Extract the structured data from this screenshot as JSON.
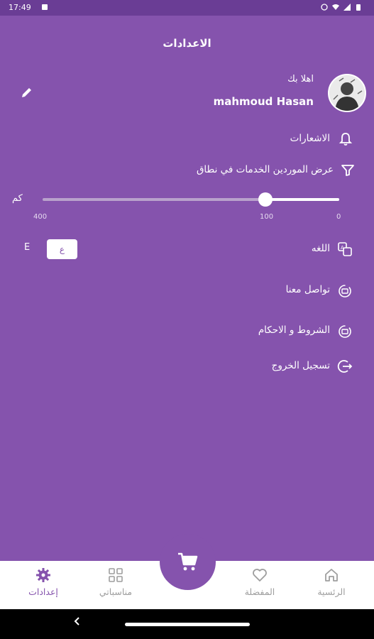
{
  "status_bar": {
    "time": "17:49"
  },
  "header": {
    "title": "الاعدادات"
  },
  "profile": {
    "greeting": "اهلا بك",
    "name": "mahmoud Hasan"
  },
  "settings": {
    "notifications_label": "الاشعارات",
    "range_label": "عرض الموردين الخدمات في نطاق",
    "range": {
      "unit": "كم",
      "min_label": "0",
      "mid_label": "100",
      "max_label": "400",
      "value_fraction": 0.25
    },
    "language_label": "اللغه",
    "language_options": [
      "ع",
      "E"
    ],
    "contact_label": "تواصل معنا",
    "terms_label": "الشروط و الاحكام",
    "logout_label": "تسجيل الخروج"
  },
  "bottom_nav": {
    "home": "الرئسية",
    "favorites": "المفضلة",
    "occasions": "مناسباتي",
    "settings": "إعدادات"
  },
  "colors": {
    "primary": "#8553ad",
    "status_bar": "#6a3d95",
    "nav_inactive": "#9e9e9e"
  }
}
